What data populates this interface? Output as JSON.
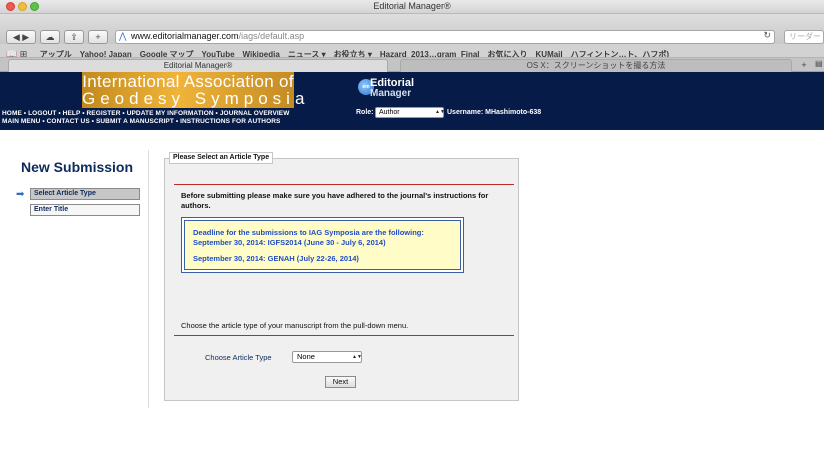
{
  "window": {
    "title": "Editorial Manager®"
  },
  "toolbar": {
    "url_host": "www.editorialmanager.com",
    "url_path": "/iags/default.asp",
    "reader_label": "リーダー"
  },
  "bookmarks": [
    "アップル",
    "Yahoo! Japan",
    "Google マップ",
    "YouTube",
    "Wikipedia",
    "ニュース ▾",
    "お役立ち ▾",
    "Hazard_2013…gram_Final",
    "お気に入り",
    "KUMail",
    "ハフィントン…ト、ハフポ)"
  ],
  "tabs": [
    {
      "label": "Editorial Manager®",
      "active": true
    },
    {
      "label": "OS X：スクリーンショットを撮る方法",
      "active": false
    }
  ],
  "header": {
    "logo_line1": "International Association of",
    "logo_line2": "Geodesy Symposia",
    "em_title": "Editorial",
    "em_subtitle": "Manager",
    "nav_row1": "HOME  •  LOGOUT  •  HELP  •  REGISTER  •  UPDATE MY INFORMATION  •  JOURNAL OVERVIEW",
    "nav_row2": "MAIN MENU  •  CONTACT US  •  SUBMIT A MANUSCRIPT  •  INSTRUCTIONS FOR AUTHORS",
    "role_label": "Role:",
    "role_value": "Author",
    "username": "Username: MHashimoto-638"
  },
  "sidebar": {
    "title": "New Submission",
    "steps": [
      "Select Article Type",
      "Enter Title"
    ]
  },
  "main": {
    "legend": "Please Select an Article Type",
    "intro": "Before submitting please make sure you have adhered to the journal's instructions for authors.",
    "notice_lines": [
      "Deadline for the submissions to IAG Symposia are the following:",
      "September 30, 2014: IGFS2014 (June 30 - July 6, 2014)",
      "September 30, 2014: GENAH (July 22-26, 2014)"
    ],
    "choose_instruction": "Choose the article type of your manuscript from the pull-down menu.",
    "choose_label": "Choose Article Type",
    "article_type_value": "None",
    "next_label": "Next"
  },
  "colors": {
    "header_bg": "#061b47",
    "logo_gold": "#f0b43a",
    "accent_red": "#c0282c",
    "notice_bg": "#fffcc8",
    "notice_text": "#1f4ec6"
  }
}
